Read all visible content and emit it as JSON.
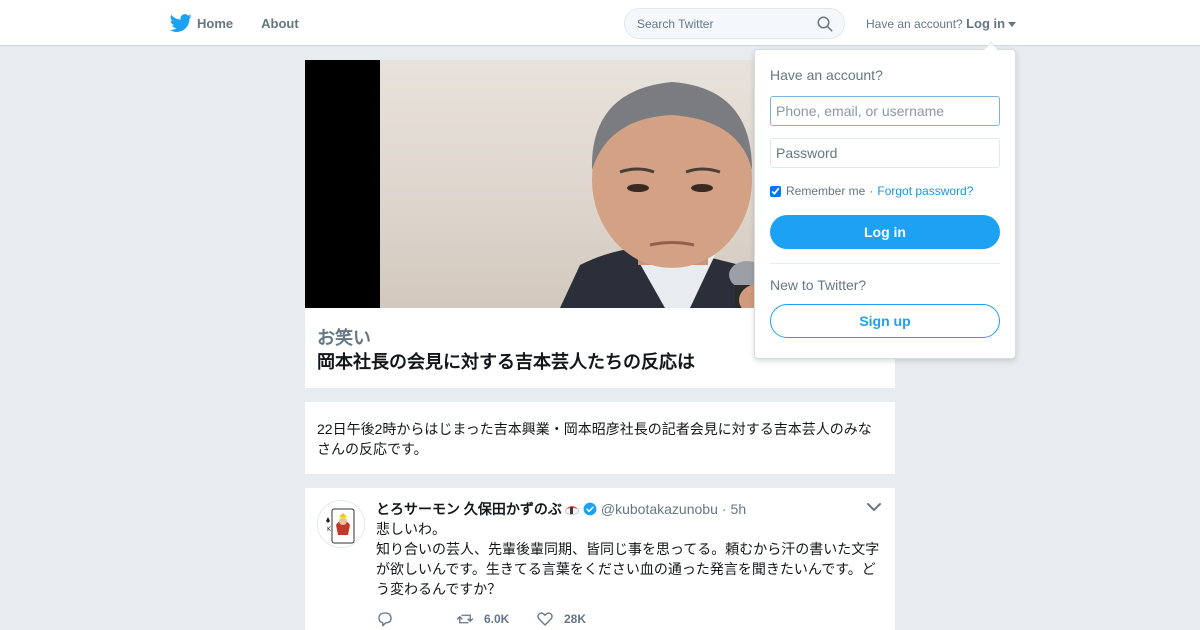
{
  "nav": {
    "home_label": "Home",
    "about_label": "About",
    "search_placeholder": "Search Twitter",
    "account_prompt": "Have an account?",
    "login_label": "Log in"
  },
  "login_dropdown": {
    "heading": "Have an account?",
    "username_placeholder": "Phone, email, or username",
    "password_placeholder": "Password",
    "remember_label": "Remember me",
    "separator": "·",
    "forgot_label": "Forgot password?",
    "login_button": "Log in",
    "new_prompt": "New to Twitter?",
    "signup_button": "Sign up"
  },
  "moment": {
    "category": "お笑い",
    "title": "岡本社長の会見に対する吉本芸人たちの反応は",
    "description": "22日午後2時からはじまった吉本興業・岡本昭彦社長の記者会見に対する吉本芸人のみなさんの反応です。"
  },
  "tweet": {
    "display_name": "とろサーモン 久保田かずのぶ",
    "handle": "@kubotakazunobu",
    "separator": "·",
    "time": "5h",
    "lines": [
      "悲しいわ。",
      "知り合いの芸人、先輩後輩同期、皆同じ事を思ってる。頼むから汗の書いた文字が欲しいんです。生きてる言葉をください血の通った発言を聞きたいんです。どう変わるんですか？"
    ],
    "retweets": "6.0K",
    "likes": "28K"
  },
  "colors": {
    "twitter_blue": "#1da1f2",
    "page_bg": "#e6ecf0",
    "secondary_text": "#657786"
  }
}
